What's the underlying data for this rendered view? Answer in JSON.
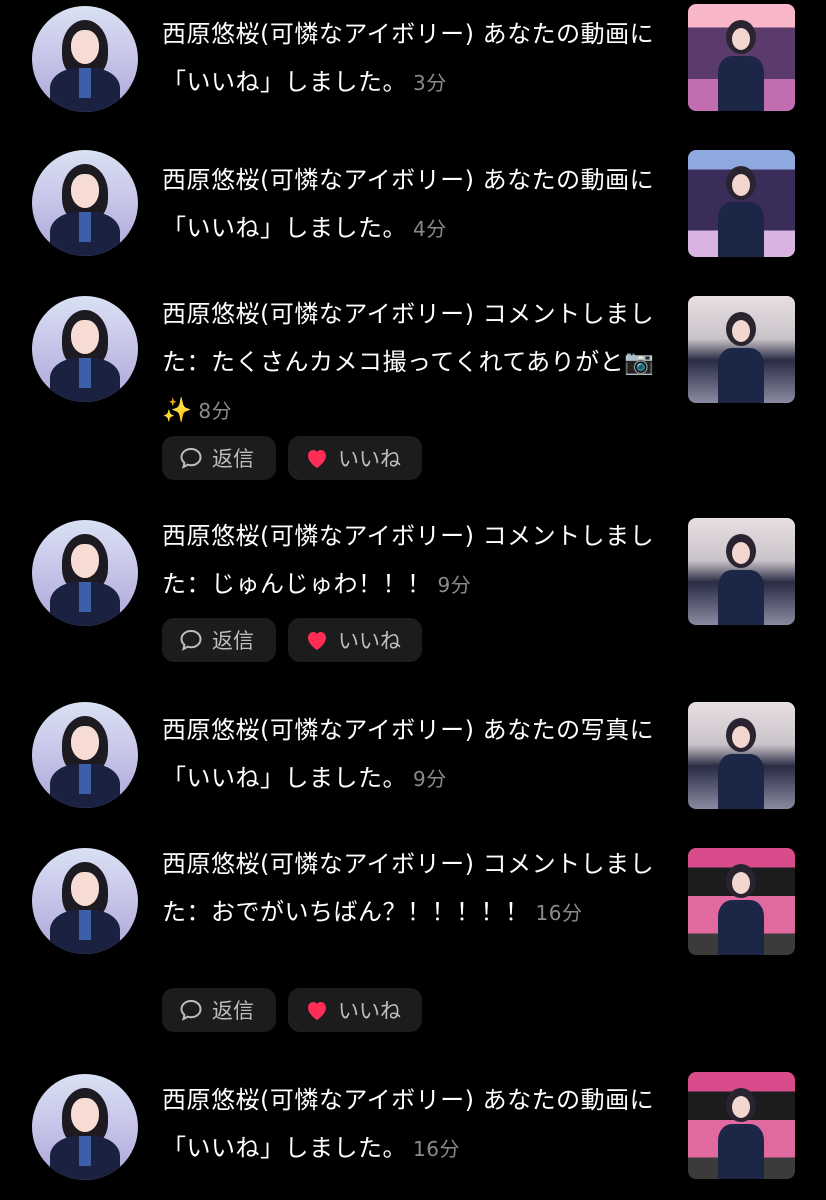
{
  "notifications": [
    {
      "text": "西原悠桜(可憐なアイボリー) あなたの動画に「いいね」しました。",
      "time": "3分",
      "thumb": "t1",
      "actions": false
    },
    {
      "text": "西原悠桜(可憐なアイボリー) あなたの動画に「いいね」しました。",
      "time": "4分",
      "thumb": "t2",
      "actions": false
    },
    {
      "text": "西原悠桜(可憐なアイボリー) コメントしました：たくさんカメコ撮ってくれてありがと📷✨",
      "time": "8分",
      "thumb": "t3",
      "actions": true
    },
    {
      "text": "西原悠桜(可憐なアイボリー) コメントしました：じゅんじゅわ！！！",
      "time": "9分",
      "thumb": "t3",
      "actions": true
    },
    {
      "text": "西原悠桜(可憐なアイボリー) あなたの写真に「いいね」しました。",
      "time": "9分",
      "thumb": "t3",
      "actions": false
    },
    {
      "text": "西原悠桜(可憐なアイボリー) コメントしました：おでがいちばん？！！！！！",
      "time": "16分",
      "thumb": "t4",
      "actions": true
    },
    {
      "text": "西原悠桜(可憐なアイボリー) あなたの動画に「いいね」しました。",
      "time": "16分",
      "thumb": "t4",
      "actions": false
    }
  ],
  "actions": {
    "reply_label": "返信",
    "like_label": "いいね"
  },
  "colors": {
    "background": "#000000",
    "like_heart": "#ff2d55",
    "pill_bg": "#1c1c1c"
  }
}
